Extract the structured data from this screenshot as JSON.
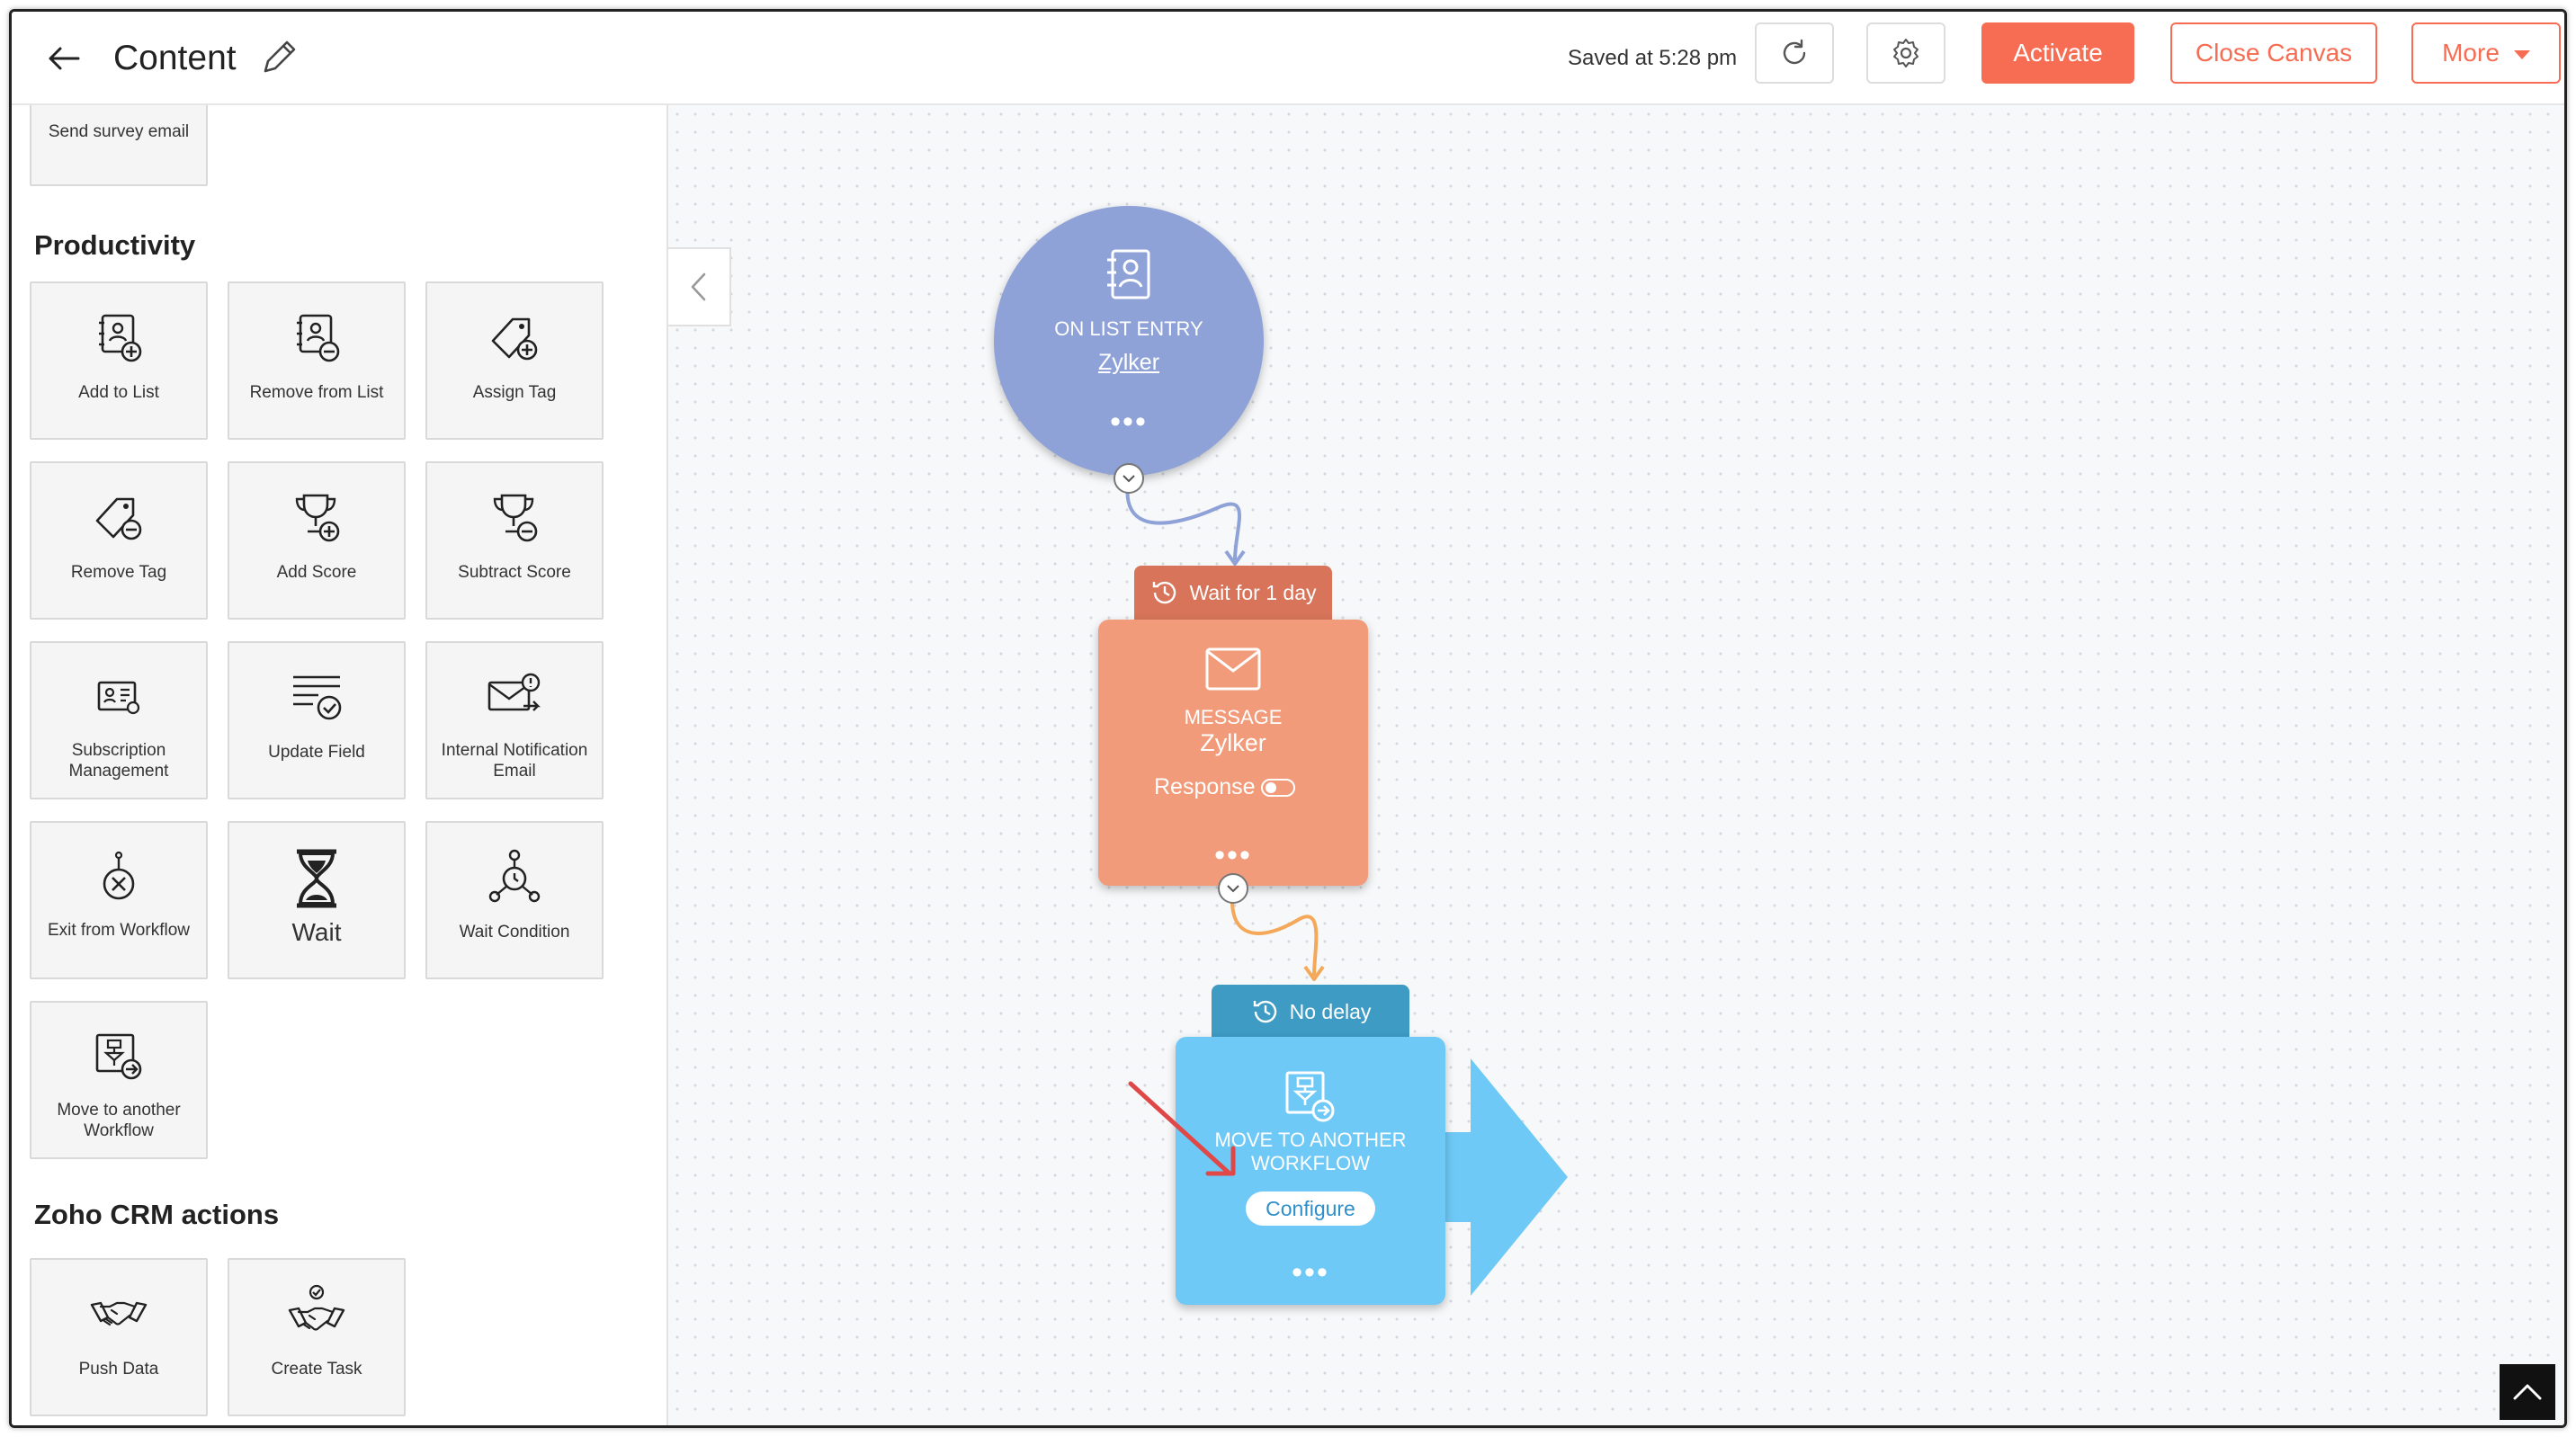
{
  "header": {
    "title": "Content",
    "saved": "Saved at 5:28 pm",
    "activate": "Activate",
    "close_canvas": "Close Canvas",
    "more": "More"
  },
  "sidebar": {
    "top_tile": "Send survey email",
    "productivity_title": "Productivity",
    "productivity": [
      {
        "label": "Add to List",
        "icon": "add-to-list-icon"
      },
      {
        "label": "Remove from List",
        "icon": "remove-from-list-icon"
      },
      {
        "label": "Assign Tag",
        "icon": "assign-tag-icon"
      },
      {
        "label": "Remove Tag",
        "icon": "remove-tag-icon"
      },
      {
        "label": "Add Score",
        "icon": "add-score-icon"
      },
      {
        "label": "Subtract Score",
        "icon": "subtract-score-icon"
      },
      {
        "label": "Subscription Management",
        "icon": "subscription-management-icon"
      },
      {
        "label": "Update Field",
        "icon": "update-field-icon"
      },
      {
        "label": "Internal Notification Email",
        "icon": "internal-notification-email-icon"
      },
      {
        "label": "Exit from Workflow",
        "icon": "exit-workflow-icon"
      },
      {
        "label": "Wait",
        "icon": "hourglass-icon"
      },
      {
        "label": "Wait Condition",
        "icon": "wait-condition-icon"
      },
      {
        "label": "Move to another Workflow",
        "icon": "move-workflow-icon"
      }
    ],
    "crm_title": "Zoho CRM actions",
    "crm": [
      {
        "label": "Push Data",
        "icon": "handshake-icon"
      },
      {
        "label": "Create Task",
        "icon": "handshake-check-icon"
      }
    ]
  },
  "canvas": {
    "entry": {
      "type": "ON LIST ENTRY",
      "list": "Zylker"
    },
    "wait_tag": "Wait for 1 day",
    "message": {
      "type": "MESSAGE",
      "name": "Zylker",
      "response": "Response"
    },
    "nodelay_tag": "No delay",
    "move": {
      "line1": "MOVE TO ANOTHER",
      "line2": "WORKFLOW",
      "configure": "Configure"
    }
  },
  "colors": {
    "accent": "#f66d53",
    "entry_node": "#8ea2d8",
    "message_node": "#f29b7a",
    "wait_tag": "#d7745a",
    "move_node": "#6fc9f6",
    "nodelay_tag": "#3d9bc4",
    "arrow_annotation": "#e04848"
  }
}
